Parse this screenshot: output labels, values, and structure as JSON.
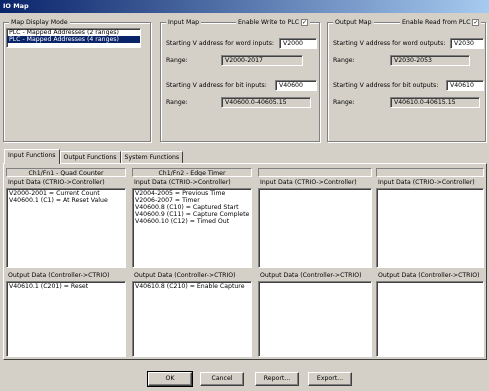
{
  "window": {
    "title": "IO Map"
  },
  "map_display_mode": {
    "title": "Map Display Mode",
    "options": [
      "PLC - Mapped Addresses (2 ranges)",
      "PLC - Mapped Addresses (4 ranges)"
    ],
    "selected_index": 1
  },
  "input_map": {
    "title": "Input Map",
    "enable_label": "Enable Write to PLC",
    "enable_checked": true,
    "word_label": "Starting V address for word inputs:",
    "word_value": "V2000",
    "word_range_label": "Range:",
    "word_range": "V2000-2017",
    "bit_label": "Starting V address for bit inputs:",
    "bit_value": "V40600",
    "bit_range_label": "Range:",
    "bit_range": "V40600.0-40605.15"
  },
  "output_map": {
    "title": "Output Map",
    "enable_label": "Enable Read from PLC",
    "enable_checked": true,
    "word_label": "Starting V address for word outputs:",
    "word_value": "V2030",
    "word_range_label": "Range:",
    "word_range": "V2030-2053",
    "bit_label": "Starting V address for bit outputs:",
    "bit_value": "V40610",
    "bit_range_label": "Range:",
    "bit_range": "V40610.0-40615.15"
  },
  "tabs": [
    "Input Functions",
    "Output Functions",
    "System Functions"
  ],
  "columns": [
    {
      "header": "Ch1/Fn1 - Quad Counter",
      "input_label": "Input Data (CTRIO->Controller)",
      "input_lines": [
        "V2000-2001 = Current Count",
        "V40600.1 (C1) = At Reset Value"
      ],
      "output_label": "Output Data (Controller->CTRIO)",
      "output_lines": [
        "V40610.1 (C201) = Reset"
      ]
    },
    {
      "header": "Ch1/Fn2 - Edge Timer",
      "input_label": "Input Data (CTRIO->Controller)",
      "input_lines": [
        "V2004-2005 = Previous Time",
        "V2006-2007 = Timer",
        "V40600.8 (C10) = Captured Start",
        "V40600.9 (C11) = Capture Complete",
        "V40600.10 (C12) = Timed Out"
      ],
      "output_label": "Output Data (Controller->CTRIO)",
      "output_lines": [
        "V40610.8 (C210) = Enable Capture"
      ]
    },
    {
      "header": "",
      "input_label": "Input Data (CTRIO->Controller)",
      "input_lines": [],
      "output_label": "Output Data (Controller->CTRIO)",
      "output_lines": []
    },
    {
      "header": "",
      "input_label": "Input Data (CTRIO->Controller)",
      "input_lines": [],
      "output_label": "Output Data (Controller->CTRIO)",
      "output_lines": []
    }
  ],
  "buttons": {
    "ok": "OK",
    "cancel": "Cancel",
    "report": "Report...",
    "export": "Export..."
  }
}
